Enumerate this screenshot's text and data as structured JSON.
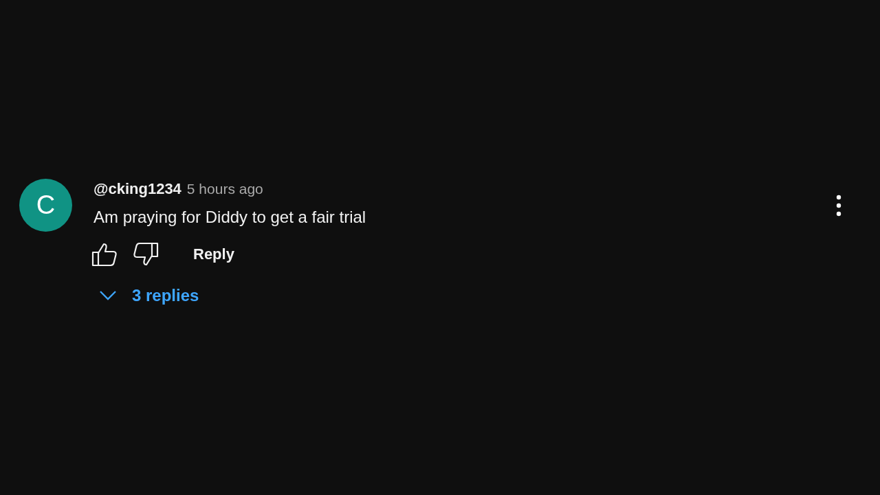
{
  "comment": {
    "avatar_letter": "C",
    "author": "@cking1234",
    "time": "5 hours ago",
    "text": "Am praying for Diddy to get a fair trial",
    "reply_button": "Reply",
    "replies_toggle": "3 replies"
  }
}
